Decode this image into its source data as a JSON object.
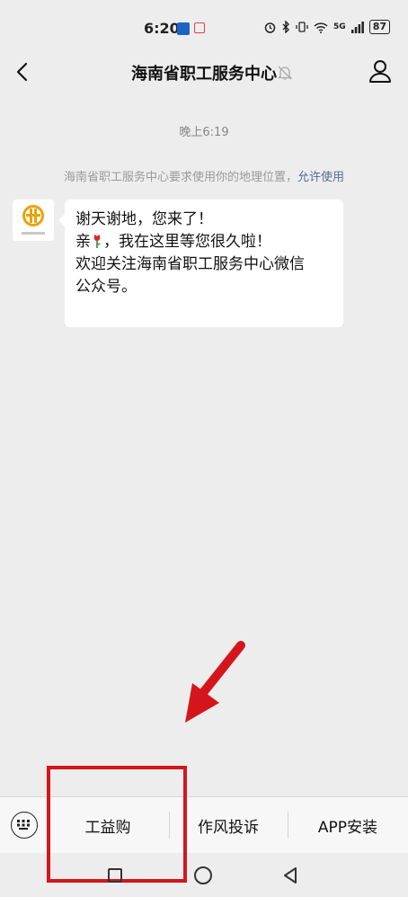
{
  "status_bar": {
    "time": "6:20",
    "battery": "87",
    "network": "5G"
  },
  "header": {
    "title": "海南省职工服务中心"
  },
  "chat": {
    "timestamp": "晚上6:19",
    "system_message": "海南省职工服务中心要求使用你的地理位置，",
    "system_link": "允许使用",
    "message_lines": [
      "谢天谢地，您来了！",
      "亲",
      "，我在这里等您很久啦！",
      "欢迎关注海南省职工服务中心微信",
      "公众号。"
    ]
  },
  "bottom_menu": {
    "items": [
      {
        "label": "工益购"
      },
      {
        "label": "作风投诉"
      },
      {
        "label": "APP安装"
      }
    ]
  },
  "colors": {
    "background": "#ededed",
    "link": "#576b95",
    "highlight": "#d4161c",
    "avatar_logo": "#e8a30c"
  },
  "icons": [
    "back-arrow-icon",
    "mute-bell-icon",
    "profile-icon",
    "keyboard-icon",
    "rose-emoji-icon",
    "red-arrow-annotation"
  ]
}
